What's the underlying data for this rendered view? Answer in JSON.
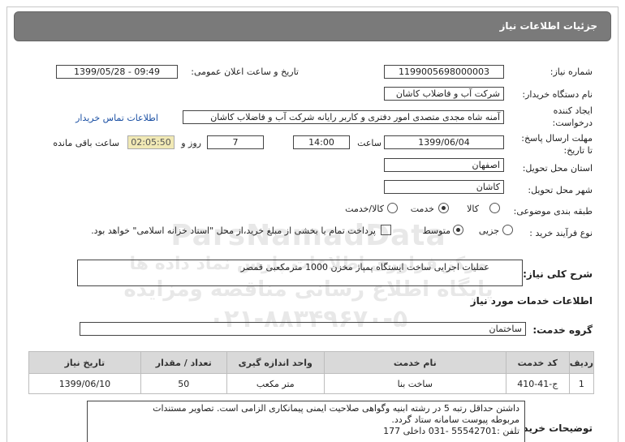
{
  "header": {
    "title": "جزئیات اطلاعات نیاز"
  },
  "fields": {
    "need_number_label": "شماره نیاز:",
    "need_number": "1199005698000003",
    "announce_label": "تاریخ و ساعت اعلان عمومی:",
    "announce_value": "1399/05/28 - 09:49",
    "buyer_label": "نام دستگاه خریدار:",
    "buyer_value": "شرکت آب و فاضلاب کاشان",
    "creator_label_1": "ایجاد کننده",
    "creator_label_2": "درخواست:",
    "creator_value": "آمنه شاه مجدی متصدی امور دفتری و کاربر رایانه شرکت آب و فاضلاب کاشان",
    "contact_link": "اطلاعات تماس خریدار",
    "deadline_label_1": "مهلت ارسال پاسخ:",
    "deadline_label_2": "تا تاریخ:",
    "deadline_date": "1399/06/04",
    "time_label": "ساعت",
    "deadline_time": "14:00",
    "days_value": "7",
    "days_label": "روز و",
    "remaining_time": "02:05:50",
    "remaining_label": "ساعت باقی مانده",
    "province_label": "استان محل تحویل:",
    "province_value": "اصفهان",
    "city_label": "شهر محل تحویل:",
    "city_value": "کاشان",
    "category_label": "طبقه بندی موضوعی:",
    "category_options": [
      "کالا",
      "خدمت",
      "کالا/خدمت"
    ],
    "category_selected": "خدمت",
    "process_label": "نوع فرآیند خرید :",
    "process_options": [
      "جزیی",
      "متوسط"
    ],
    "process_selected": "متوسط",
    "payment_note": "پرداخت تمام یا بخشی از مبلغ خرید،از محل \"اسناد خزانه اسلامی\" خواهد بود."
  },
  "summary": {
    "label": "شرح کلی نیاز:",
    "value": "عملیات اجرایی ساخت ایستگاه پمپاژ مخزن 1000 مترمکعبی قمصر"
  },
  "services_section": {
    "title": "اطلاعات خدمات مورد نیاز",
    "group_label": "گروه خدمت:",
    "group_value": "ساختمان"
  },
  "table": {
    "headers": [
      "ردیف",
      "کد خدمت",
      "نام خدمت",
      "واحد اندازه گیری",
      "تعداد / مقدار",
      "تاریخ نیاز"
    ],
    "rows": [
      [
        "1",
        "ج-41-410",
        "ساخت بنا",
        "متر مکعب",
        "50",
        "1399/06/10"
      ]
    ]
  },
  "buyer_notes": {
    "label": "توضیحات خریدار:",
    "lines": [
      "داشتن حداقل رتبه 5 در رشته ابنیه وگواهی صلاحیت ایمنی پیمانکاری الزامی است. تصاویر مستندات",
      "مربوطه پیوست سامانه ستاد گردد.",
      "تلفن :55542701 -031 داخلی 177"
    ]
  },
  "watermark": {
    "line1": "ParsNamadData",
    "line2": "مرکز فراوری اطلاعات پارس نماد داده ها",
    "line3": "پایگاه اطلاع رسانی مناقصه ومزایده",
    "line4": "۰۲۱-۸۸۳۴۹۶۷۰-۵"
  }
}
